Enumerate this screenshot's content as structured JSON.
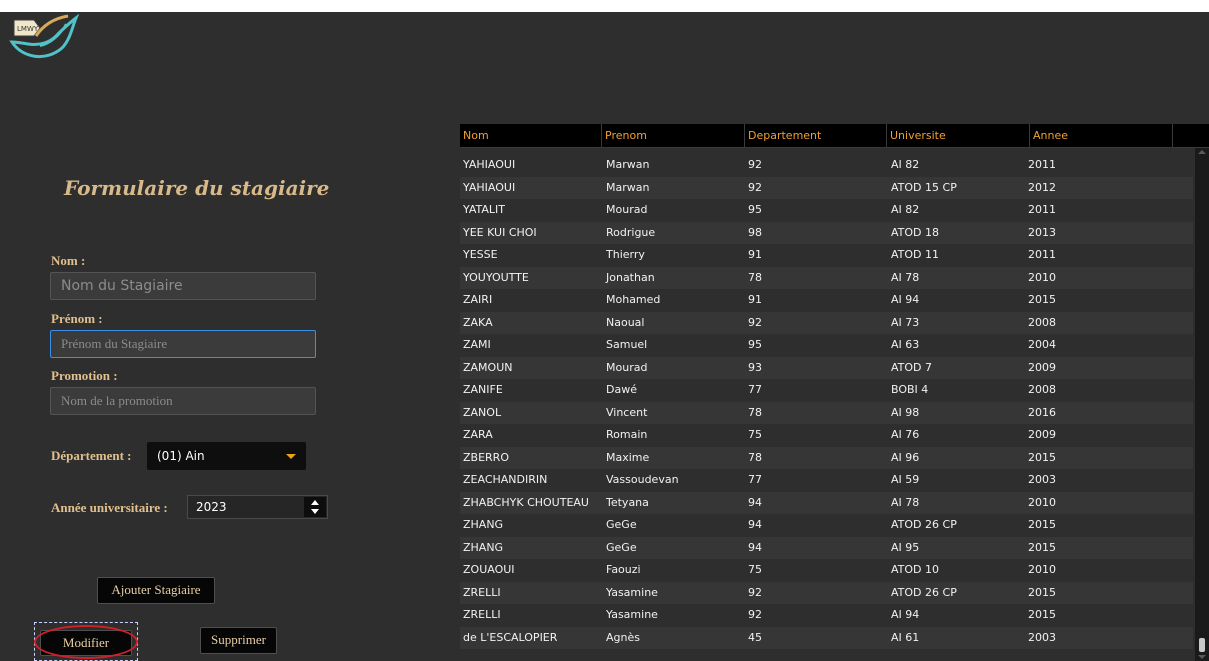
{
  "logo": {
    "text": "LMWY",
    "name": "bird-logo-icon"
  },
  "form": {
    "title": "Formulaire du stagiaire",
    "nom_label": "Nom :",
    "nom_placeholder": "Nom du Stagiaire",
    "prenom_label": "Prénom :",
    "prenom_placeholder": "Prénom du Stagiaire",
    "promotion_label": "Promotion :",
    "promotion_placeholder": "Nom de la promotion",
    "departement_label": "Département :",
    "departement_value": "(01) Ain",
    "annee_label": "Année universitaire :",
    "annee_value": "2023",
    "add_button": "Ajouter Stagiaire",
    "modify_button": "Modifier",
    "delete_button": "Supprimer"
  },
  "table": {
    "columns": [
      "Nom",
      "Prenom",
      "Departement",
      "Universite",
      "Annee"
    ],
    "rows": [
      [
        "YAHIAOUI",
        "Marwan",
        "92",
        "AI 82",
        "2011"
      ],
      [
        "YAHIAOUI",
        "Marwan",
        "92",
        "ATOD 15 CP",
        "2012"
      ],
      [
        "YATALIT",
        "Mourad",
        "95",
        "AI 82",
        "2011"
      ],
      [
        "YEE KUI CHOI",
        "Rodrigue",
        "98",
        "ATOD 18",
        "2013"
      ],
      [
        "YESSE",
        "Thierry",
        "91",
        "ATOD 11",
        "2011"
      ],
      [
        "YOUYOUTTE",
        "Jonathan",
        "78",
        "AI 78",
        "2010"
      ],
      [
        "ZAIRI",
        "Mohamed",
        "91",
        "AI 94",
        "2015"
      ],
      [
        "ZAKA",
        "Naoual",
        "92",
        "AI 73",
        "2008"
      ],
      [
        "ZAMI",
        "Samuel",
        "95",
        "AI 63",
        "2004"
      ],
      [
        "ZAMOUN",
        "Mourad",
        "93",
        "ATOD 7",
        "2009"
      ],
      [
        "ZANIFE",
        "Dawé",
        "77",
        "BOBI 4",
        "2008"
      ],
      [
        "ZANOL",
        "Vincent",
        "78",
        "AI 98",
        "2016"
      ],
      [
        "ZARA",
        "Romain",
        "75",
        "AI 76",
        "2009"
      ],
      [
        "ZBERRO",
        "Maxime",
        "78",
        "AI 96",
        "2015"
      ],
      [
        "ZEACHANDIRIN",
        "Vassoudevan",
        "77",
        "AI 59",
        "2003"
      ],
      [
        "ZHABCHYK CHOUTEAU",
        "Tetyana",
        "94",
        "AI 78",
        "2010"
      ],
      [
        "ZHANG",
        "GeGe",
        "94",
        "ATOD 26 CP",
        "2015"
      ],
      [
        "ZHANG",
        "GeGe",
        "94",
        "AI 95",
        "2015"
      ],
      [
        "ZOUAOUI",
        "Faouzi",
        "75",
        "ATOD 10",
        "2010"
      ],
      [
        "ZRELLI",
        "Yasamine",
        "92",
        "ATOD 26 CP",
        "2015"
      ],
      [
        "ZRELLI",
        "Yasamine",
        "92",
        "AI 94",
        "2015"
      ],
      [
        "de L'ESCALOPIER",
        "Agnès",
        "45",
        "AI 61",
        "2003"
      ]
    ]
  },
  "colors": {
    "background": "#2e2e2e",
    "label_gold": "#e0c08e",
    "header_orange": "#f0a030",
    "focus_blue": "#3d8ee8",
    "highlight_red": "#d0202a"
  }
}
